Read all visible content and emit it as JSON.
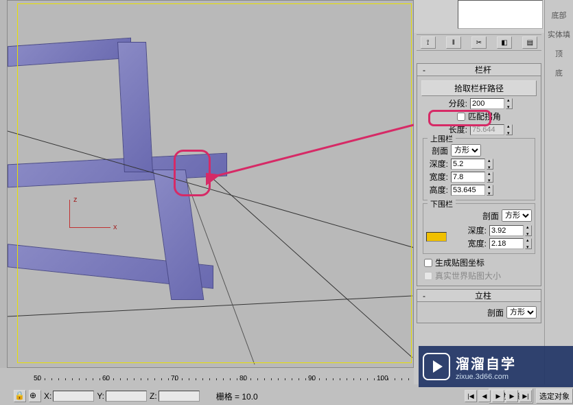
{
  "rollouts": {
    "railing": {
      "title": "栏杆",
      "pick_path_btn": "拾取栏杆路径",
      "segments_label": "分段:",
      "segments_value": "200",
      "match_corners": "匹配拐角",
      "length_label": "长度:",
      "length_value": "75.644"
    },
    "upper_rail": {
      "legend": "上围栏",
      "profile_label": "剖面",
      "profile_value": "方形",
      "depth_label": "深度:",
      "depth_value": "5.2",
      "width_label": "宽度:",
      "width_value": "7.8",
      "height_label": "高度:",
      "height_value": "53.645"
    },
    "lower_rail": {
      "legend": "下围栏",
      "profile_label": "剖面",
      "profile_value": "方形",
      "depth_label": "深度:",
      "depth_value": "3.92",
      "width_label": "宽度:",
      "width_value": "2.18"
    },
    "gen_map": "生成贴图坐标",
    "real_world": "真实世界贴图大小",
    "posts": {
      "title": "立柱",
      "profile_label": "剖面",
      "profile_value": "方形"
    }
  },
  "far_right": {
    "item1": "底部",
    "item2": "实体填",
    "item3": "顶",
    "item4": "底"
  },
  "ruler": {
    "ticks": [
      "50",
      "60",
      "70",
      "80",
      "90",
      "100"
    ]
  },
  "status": {
    "x_label": "X:",
    "y_label": "Y:",
    "z_label": "Z:",
    "grid_label": "栅格 = 10.0",
    "auto_key": "自动关键点",
    "sel_obj": "选定对象"
  },
  "watermark": {
    "big": "溜溜自学",
    "small": "zixue.3d66.com"
  },
  "gizmo": {
    "z": "z",
    "x": "x"
  },
  "profile_options": [
    "方形"
  ]
}
